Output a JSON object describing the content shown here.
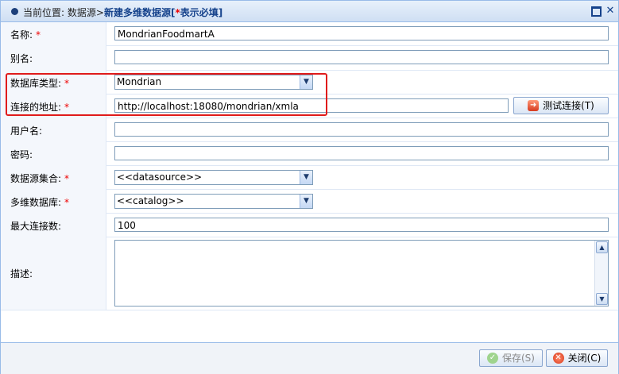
{
  "titlebar": {
    "location_label": "当前位置:",
    "breadcrumb_parent": "数据源>",
    "breadcrumb_current": "新建多维数据源[",
    "required_marker": "*",
    "required_note": "表示必填]"
  },
  "form": {
    "name": {
      "label": "名称:",
      "required": "*",
      "value": "MondrianFoodmartA"
    },
    "alias": {
      "label": "别名:",
      "value": ""
    },
    "db_type": {
      "label": "数据库类型:",
      "required": "*",
      "value": "Mondrian"
    },
    "url": {
      "label": "连接的地址:",
      "required": "*",
      "value": "http://localhost:18080/mondrian/xmla"
    },
    "test_button": "测试连接(T)",
    "username": {
      "label": "用户名:",
      "value": ""
    },
    "password": {
      "label": "密码:",
      "value": ""
    },
    "datasource_set": {
      "label": "数据源集合:",
      "required": "*",
      "value": "<<datasource>>"
    },
    "catalog": {
      "label": "多维数据库:",
      "required": "*",
      "value": "<<catalog>>"
    },
    "max_connections": {
      "label": "最大连接数:",
      "value": "100"
    },
    "description": {
      "label": "描述:",
      "value": ""
    }
  },
  "footer": {
    "save_label": "保存(S)",
    "close_label": "关闭(C)"
  },
  "colors": {
    "highlight": "#e01b1b",
    "required": "#ee0000",
    "title_text": "#15428b"
  }
}
